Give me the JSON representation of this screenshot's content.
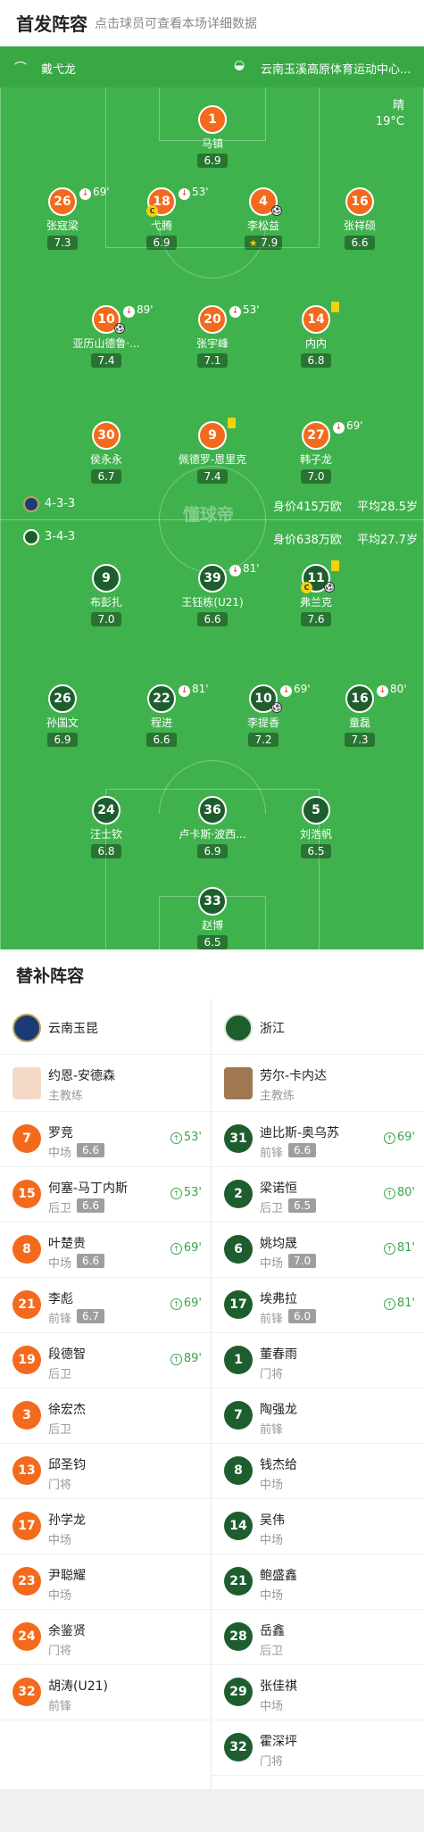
{
  "header": {
    "title": "首发阵容",
    "subtitle": "点击球员可查看本场详细数据"
  },
  "match_info": {
    "referee": "戴弋龙",
    "venue": "云南玉溪高原体育运动中心...",
    "weather": "晴",
    "temperature": "19°C",
    "watermark": "懂球帝"
  },
  "colors": {
    "home": "#f46a1c",
    "away": "#1e5e2e",
    "pitch": "#3fb24d"
  },
  "home_team": {
    "name": "云南玉昆",
    "formation": "4-3-3",
    "value": "身价415万欧",
    "age": "平均28.5岁",
    "players": [
      {
        "num": "1",
        "name": "马镇",
        "rating": "6.9"
      },
      {
        "num": "26",
        "name": "张寇梁",
        "rating": "7.3",
        "sub_off": "69'"
      },
      {
        "num": "18",
        "name": "弋腾",
        "rating": "6.9",
        "sub_off": "53'",
        "captain": true
      },
      {
        "num": "4",
        "name": "李松益",
        "rating": "7.9",
        "goal": true,
        "mvp": true
      },
      {
        "num": "16",
        "name": "张祥硕",
        "rating": "6.6"
      },
      {
        "num": "10",
        "name": "亚历山德鲁·...",
        "rating": "7.4",
        "sub_off": "89'",
        "goal": true
      },
      {
        "num": "20",
        "name": "张宇峰",
        "rating": "7.1",
        "sub_off": "53'"
      },
      {
        "num": "14",
        "name": "内内",
        "rating": "6.8",
        "yellow": true
      },
      {
        "num": "30",
        "name": "侯永永",
        "rating": "6.7"
      },
      {
        "num": "9",
        "name": "佩德罗-恩里克",
        "rating": "7.4",
        "yellow": true
      },
      {
        "num": "27",
        "name": "韩子龙",
        "rating": "7.0",
        "sub_off": "69'"
      }
    ]
  },
  "away_team": {
    "name": "浙江",
    "formation": "3-4-3",
    "value": "身价638万欧",
    "age": "平均27.7岁",
    "players": [
      {
        "num": "9",
        "name": "布彭扎",
        "rating": "7.0"
      },
      {
        "num": "39",
        "name": "王钰栋(U21)",
        "rating": "6.6",
        "sub_off": "81'"
      },
      {
        "num": "11",
        "name": "弗兰克",
        "rating": "7.6",
        "yellow": true,
        "captain": true,
        "goal": true
      },
      {
        "num": "26",
        "name": "孙国文",
        "rating": "6.9"
      },
      {
        "num": "22",
        "name": "程进",
        "rating": "6.6",
        "sub_off": "81'"
      },
      {
        "num": "10",
        "name": "李提香",
        "rating": "7.2",
        "sub_off": "69'",
        "goal": true
      },
      {
        "num": "16",
        "name": "童磊",
        "rating": "7.3",
        "sub_off": "80'"
      },
      {
        "num": "24",
        "name": "汪士钦",
        "rating": "6.8"
      },
      {
        "num": "36",
        "name": "卢卡斯·波西...",
        "rating": "6.9"
      },
      {
        "num": "5",
        "name": "刘浩帆",
        "rating": "6.5"
      },
      {
        "num": "33",
        "name": "赵博",
        "rating": "6.5"
      }
    ]
  },
  "subs_section": {
    "title": "替补阵容",
    "home": {
      "team": "云南玉昆",
      "coach": {
        "name": "约恩-安德森",
        "role": "主教练"
      },
      "subs": [
        {
          "num": "7",
          "name": "罗竞",
          "pos": "中场",
          "rating": "6.6",
          "min": "53'"
        },
        {
          "num": "15",
          "name": "何塞-马丁内斯",
          "pos": "后卫",
          "rating": "6.6",
          "min": "53'"
        },
        {
          "num": "8",
          "name": "叶楚贵",
          "pos": "中场",
          "rating": "6.6",
          "min": "69'"
        },
        {
          "num": "21",
          "name": "李彪",
          "pos": "前锋",
          "rating": "6.7",
          "min": "69'"
        },
        {
          "num": "19",
          "name": "段德智",
          "pos": "后卫",
          "rating": "",
          "min": "89'"
        },
        {
          "num": "3",
          "name": "徐宏杰",
          "pos": "后卫",
          "rating": "",
          "min": ""
        },
        {
          "num": "13",
          "name": "邱圣钧",
          "pos": "门将",
          "rating": "",
          "min": ""
        },
        {
          "num": "17",
          "name": "孙学龙",
          "pos": "中场",
          "rating": "",
          "min": ""
        },
        {
          "num": "23",
          "name": "尹聪耀",
          "pos": "中场",
          "rating": "",
          "min": ""
        },
        {
          "num": "24",
          "name": "余鉴贤",
          "pos": "门将",
          "rating": "",
          "min": ""
        },
        {
          "num": "32",
          "name": "胡涛(U21)",
          "pos": "前锋",
          "rating": "",
          "min": ""
        }
      ]
    },
    "away": {
      "team": "浙江",
      "coach": {
        "name": "劳尔-卡内达",
        "role": "主教练"
      },
      "subs": [
        {
          "num": "31",
          "name": "迪比斯-奥乌苏",
          "pos": "前锋",
          "rating": "6.6",
          "min": "69'"
        },
        {
          "num": "2",
          "name": "梁诺恒",
          "pos": "后卫",
          "rating": "6.5",
          "min": "80'"
        },
        {
          "num": "6",
          "name": "姚均晟",
          "pos": "中场",
          "rating": "7.0",
          "min": "81'"
        },
        {
          "num": "17",
          "name": "埃弗拉",
          "pos": "前锋",
          "rating": "6.0",
          "min": "81'"
        },
        {
          "num": "1",
          "name": "董春雨",
          "pos": "门将",
          "rating": "",
          "min": ""
        },
        {
          "num": "7",
          "name": "陶强龙",
          "pos": "前锋",
          "rating": "",
          "min": ""
        },
        {
          "num": "8",
          "name": "钱杰给",
          "pos": "中场",
          "rating": "",
          "min": ""
        },
        {
          "num": "14",
          "name": "吴伟",
          "pos": "中场",
          "rating": "",
          "min": ""
        },
        {
          "num": "21",
          "name": "鲍盛鑫",
          "pos": "中场",
          "rating": "",
          "min": ""
        },
        {
          "num": "28",
          "name": "岳鑫",
          "pos": "后卫",
          "rating": "",
          "min": ""
        },
        {
          "num": "29",
          "name": "张佳祺",
          "pos": "中场",
          "rating": "",
          "min": ""
        },
        {
          "num": "32",
          "name": "霍深坪",
          "pos": "门将",
          "rating": "",
          "min": ""
        }
      ]
    }
  }
}
